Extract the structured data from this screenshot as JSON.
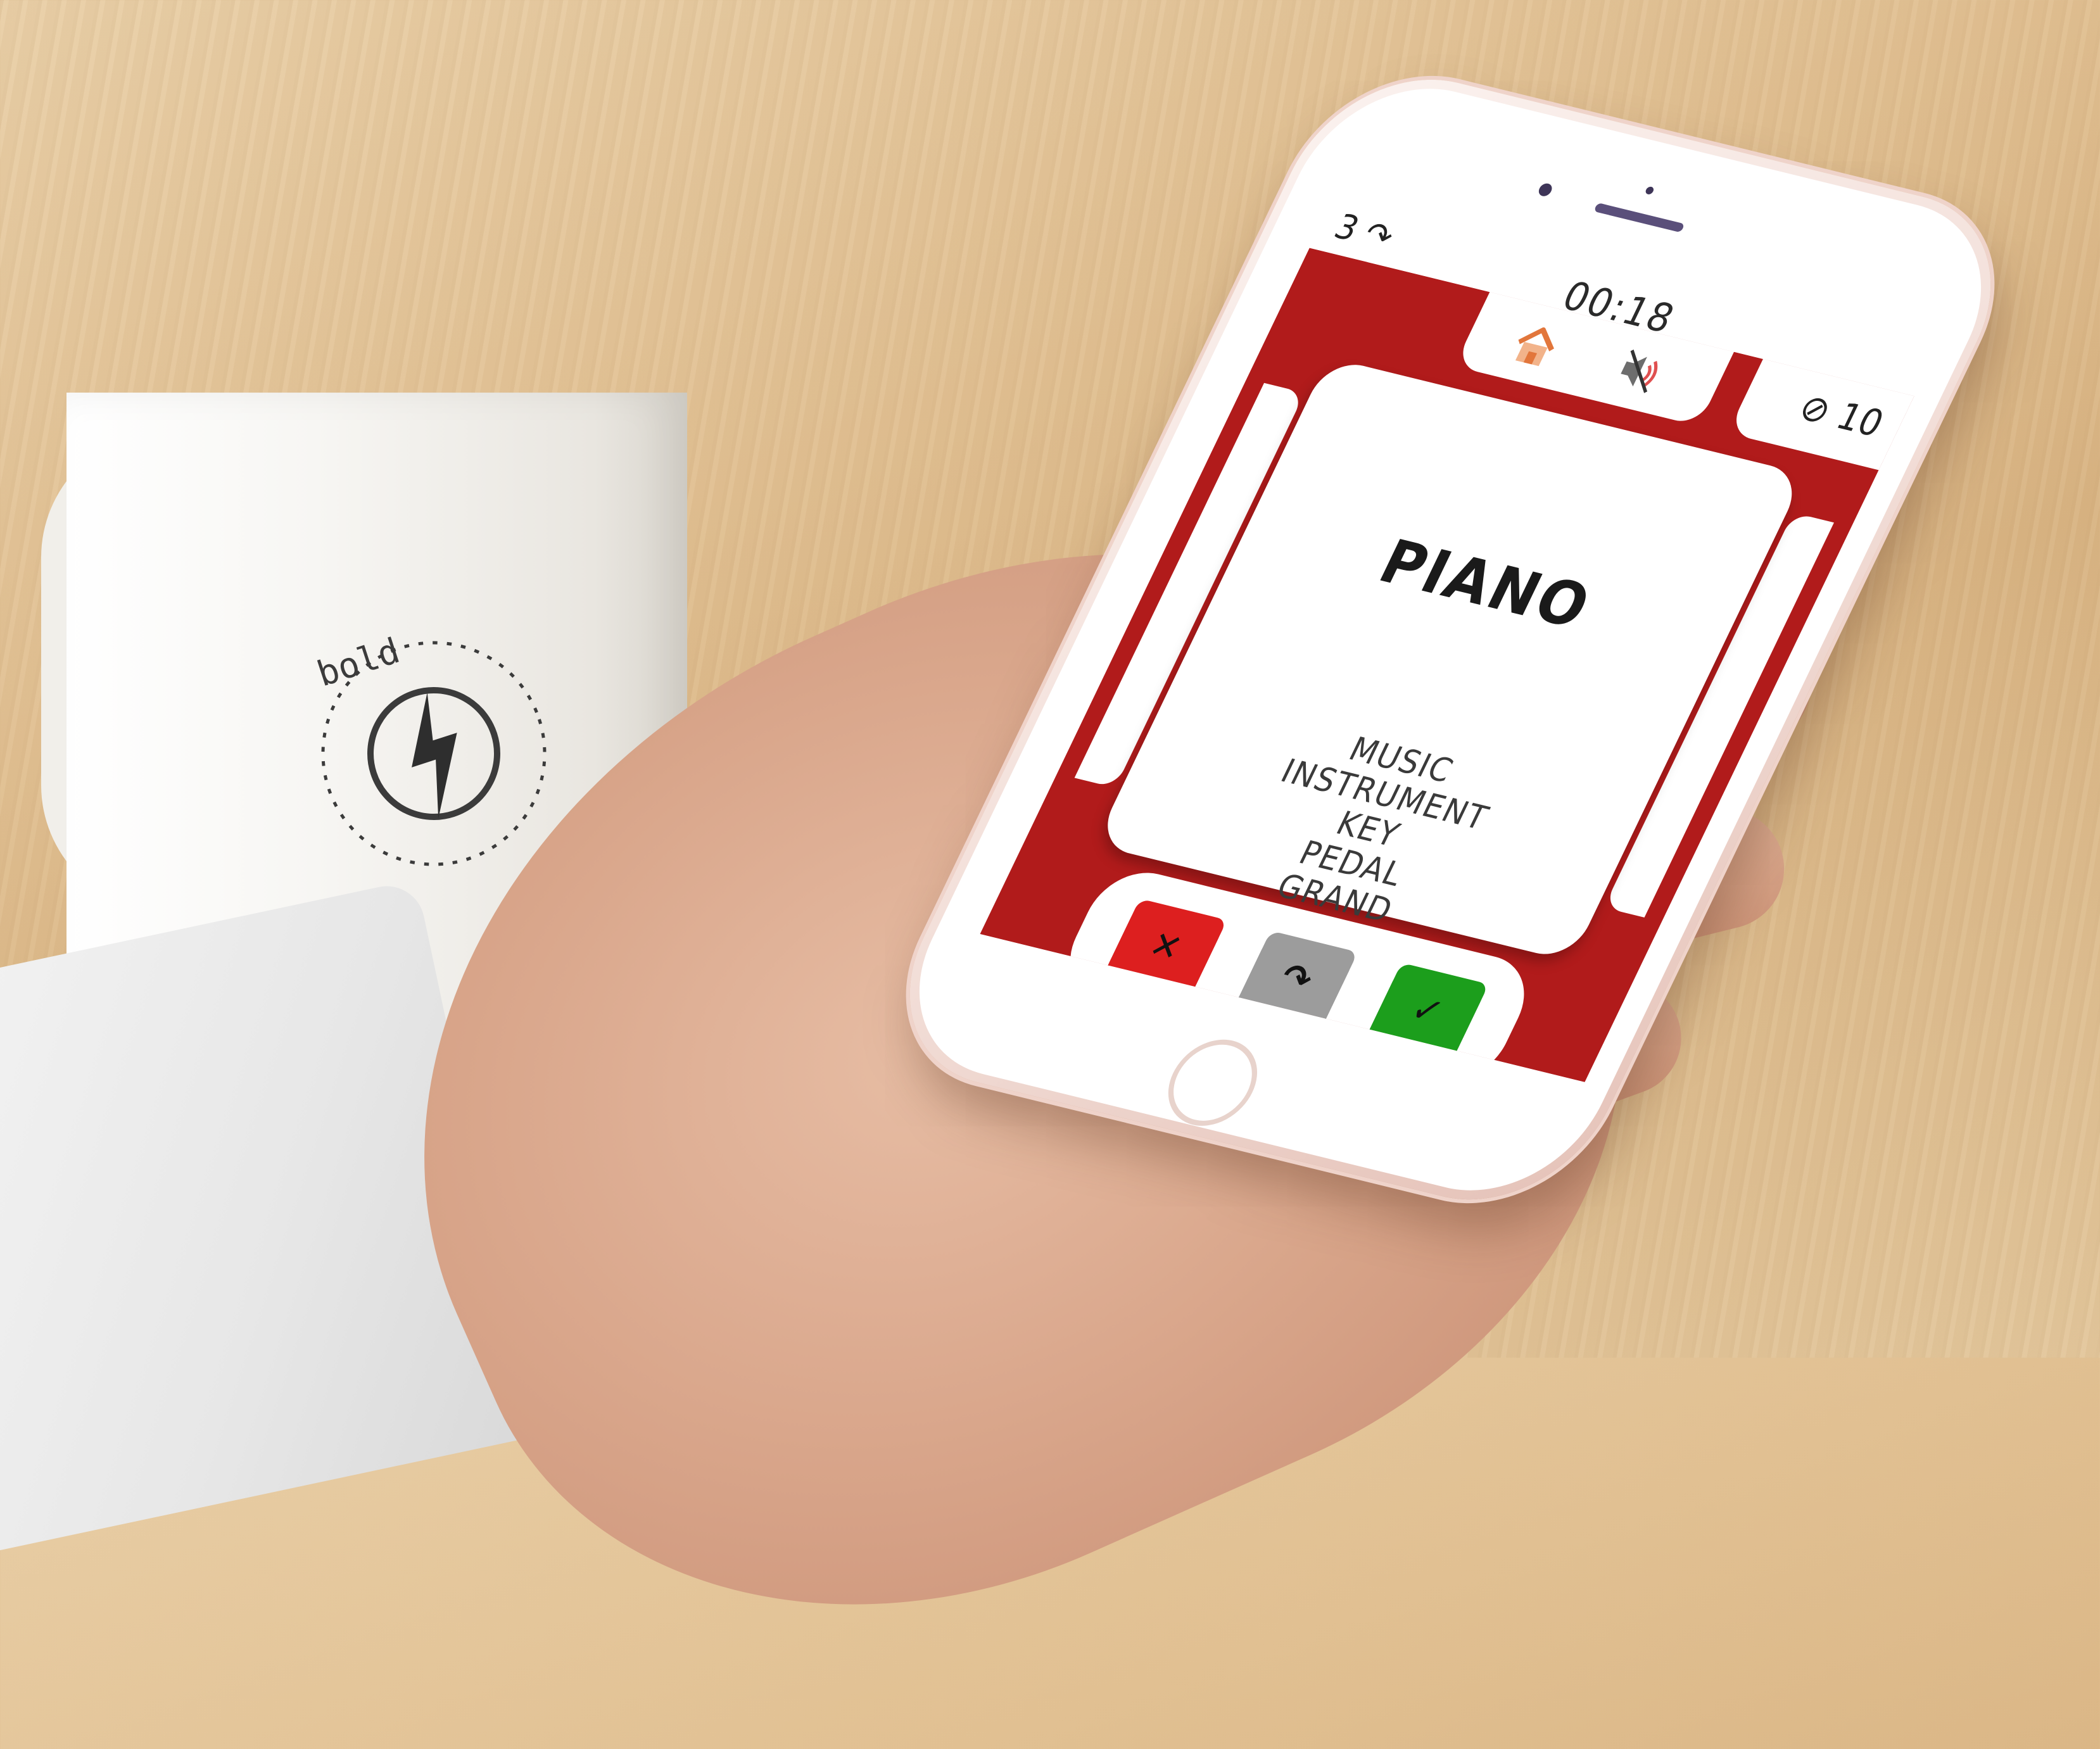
{
  "mug": {
    "logo_text": "bold"
  },
  "game": {
    "skips_left": "3",
    "skip_glyph": "↷",
    "timer": "00:18",
    "score": "10",
    "score_icon": "check-circle-icon",
    "card": {
      "word": "PIANO",
      "taboo_words": [
        "MUSIC",
        "INSTRUMENT",
        "KEY",
        "PEDAL",
        "GRAND"
      ]
    },
    "buttons": {
      "wrong": "✕",
      "skip": "↷",
      "correct": "✓"
    }
  },
  "colors": {
    "accent_red": "#b11b1b",
    "wrong_red": "#dd1f1f",
    "skip_gray": "#9c9c9c",
    "correct_green": "#1c9e1c"
  }
}
